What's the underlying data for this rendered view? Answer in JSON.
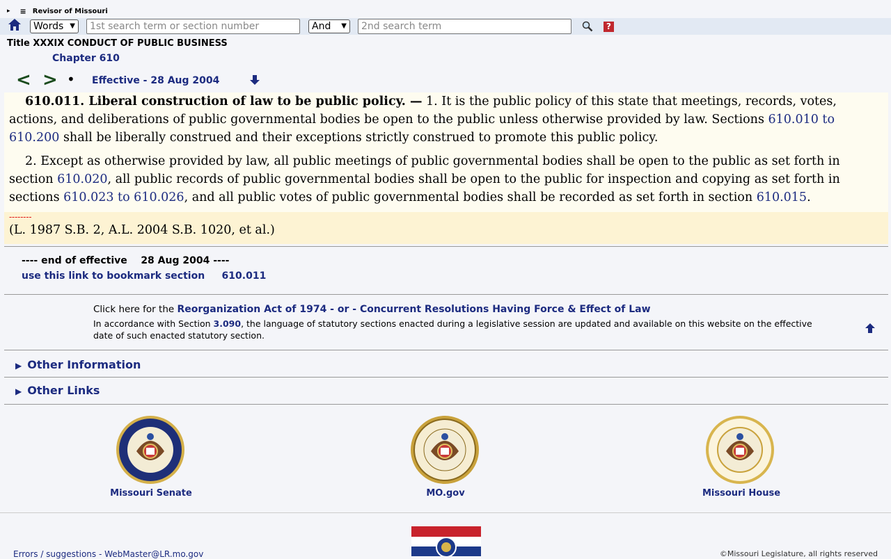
{
  "topbar": {
    "expand_glyph": "▸",
    "menu_glyph": "≡",
    "site_name": "Revisor of Missouri"
  },
  "search": {
    "type_value": "Words",
    "term1_placeholder": "1st search term or section number",
    "operator_value": "And",
    "term2_placeholder": "2nd search term",
    "help_label": "?"
  },
  "heading": {
    "title": "Title XXXIX CONDUCT OF PUBLIC BUSINESS",
    "chapter": "Chapter 610"
  },
  "nav": {
    "prev": "<",
    "next": ">",
    "bullet": "•",
    "effective": "Effective - 28 Aug 2004"
  },
  "section": {
    "number_title": "610.011.  Liberal construction of law to be public policy. —",
    "p1_a": " 1.  It is the public policy of this state that meetings, records, votes, actions, and deliberations of public governmental bodies be open to the public unless otherwise provided by law.  Sections ",
    "p1_link": "610.010 to 610.200",
    "p1_b": " shall be liberally construed and their exceptions strictly construed to promote this public policy.",
    "p2_a": "2.  Except as otherwise provided by law, all public meetings of public governmental bodies shall be open to the public as set forth in section ",
    "p2_link1": "610.020",
    "p2_b": ", all public records of public governmental bodies shall be open to the public for inspection and copying as set forth in sections ",
    "p2_link2": "610.023 to 610.026",
    "p2_c": ", and all public votes of public governmental bodies shall be recorded as set forth in section ",
    "p2_link3": "610.015",
    "p2_d": ".",
    "dashes": "--------",
    "history": "(L. 1987 S.B. 2, A.L. 2004 S.B. 1020, et al.)"
  },
  "end": {
    "end_label": "---- end of effective",
    "end_date": "28 Aug 2004",
    "end_tail": "----",
    "bookmark_label": "use this link to bookmark section",
    "bookmark_section": "610.011"
  },
  "note": {
    "click_here": "Click here for the ",
    "reorg_link": "Reorganization Act of 1974 - or - Concurrent Resolutions Having Force & Effect of Law",
    "accordance_a": "In accordance with Section ",
    "accordance_link": "3.090",
    "accordance_b": ", the language of statutory sections enacted during a legislative session are updated and available on this website on the effective date of such enacted statutory section."
  },
  "accordions": {
    "other_info": "Other Information",
    "other_links": "Other Links"
  },
  "seals": {
    "senate": "Missouri Senate",
    "mo_gov": "MO.gov",
    "house": "Missouri House"
  },
  "footer": {
    "left": "Errors / suggestions - WebMaster@LR.mo.gov",
    "right": "©Missouri Legislature, all rights reserved"
  },
  "colors": {
    "link": "#1c2b80",
    "search_bar": "#e2e9f3",
    "section_bg": "#fefcf0",
    "history_bg": "#fdf3d3",
    "help_red": "#c0282e"
  }
}
